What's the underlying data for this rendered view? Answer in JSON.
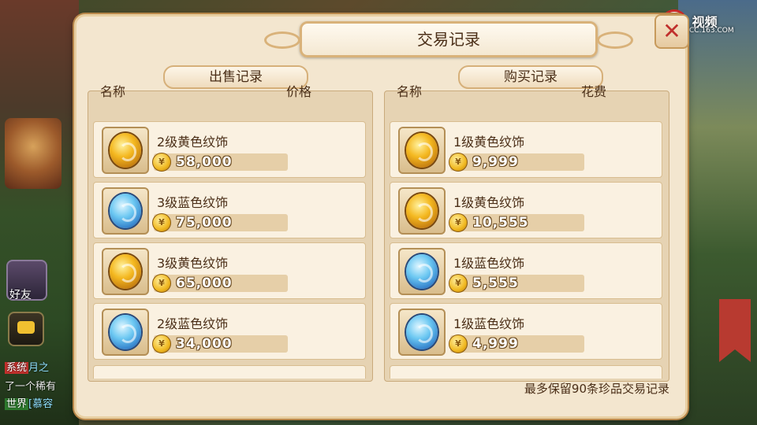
{
  "window": {
    "title": "交易记录"
  },
  "sell": {
    "header": "出售记录",
    "col_name": "名称",
    "col_price": "价格",
    "items": [
      {
        "name": "2级黄色纹饰",
        "price": "58,000",
        "gem": "yellow"
      },
      {
        "name": "3级蓝色纹饰",
        "price": "75,000",
        "gem": "blue"
      },
      {
        "name": "3级黄色纹饰",
        "price": "65,000",
        "gem": "yellow"
      },
      {
        "name": "2级蓝色纹饰",
        "price": "34,000",
        "gem": "blue"
      }
    ]
  },
  "buy": {
    "header": "购买记录",
    "col_name": "名称",
    "col_cost": "花费",
    "items": [
      {
        "name": "1级黄色纹饰",
        "price": "9,999",
        "gem": "yellow"
      },
      {
        "name": "1级黄色纹饰",
        "price": "10,555",
        "gem": "yellow"
      },
      {
        "name": "1级蓝色纹饰",
        "price": "5,555",
        "gem": "blue"
      },
      {
        "name": "1级蓝色纹饰",
        "price": "4,999",
        "gem": "blue"
      }
    ]
  },
  "footer_note": "最多保留90条珍品交易记录",
  "sidebar": {
    "friends_label": "好友"
  },
  "chat": {
    "lines": [
      {
        "tag": "系统",
        "name": "月之",
        "text": ""
      },
      {
        "tag": "",
        "name": "",
        "text": "了一个稀有"
      },
      {
        "tag": "世界",
        "name": "[慕容",
        "text": ""
      }
    ]
  },
  "watermark": {
    "brand": "视频",
    "sub": "CC.163.COM"
  },
  "colors": {
    "panel_bg": "#f3e6cf",
    "accent": "#c0302c",
    "yellow_gem": "#f4b820",
    "blue_gem": "#6cc8f2"
  }
}
